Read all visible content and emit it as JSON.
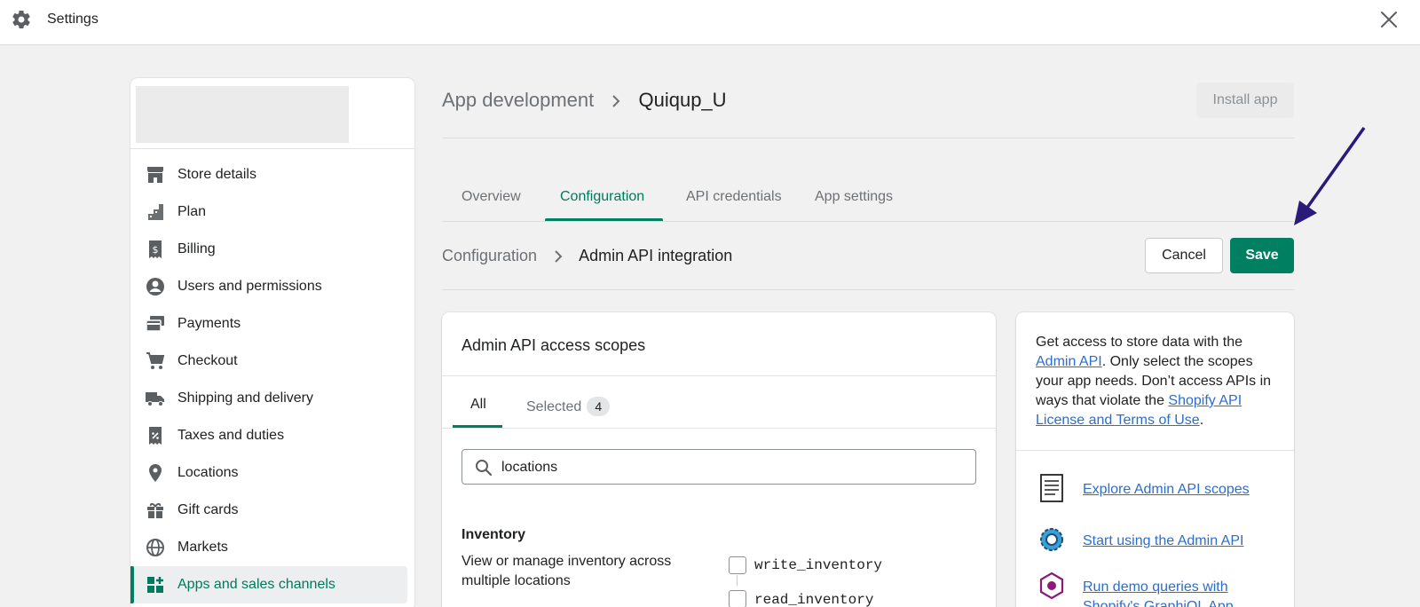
{
  "window": {
    "title": "Settings",
    "icons": {
      "settings": "gear-icon",
      "close": "close-icon"
    }
  },
  "sidebar": {
    "items": [
      {
        "label": "Store details",
        "icon": "store-icon"
      },
      {
        "label": "Plan",
        "icon": "plan-icon"
      },
      {
        "label": "Billing",
        "icon": "billing-icon"
      },
      {
        "label": "Users and permissions",
        "icon": "user-icon"
      },
      {
        "label": "Payments",
        "icon": "payments-icon"
      },
      {
        "label": "Checkout",
        "icon": "cart-icon"
      },
      {
        "label": "Shipping and delivery",
        "icon": "truck-icon"
      },
      {
        "label": "Taxes and duties",
        "icon": "tax-icon"
      },
      {
        "label": "Locations",
        "icon": "location-pin-icon"
      },
      {
        "label": "Gift cards",
        "icon": "gift-icon"
      },
      {
        "label": "Markets",
        "icon": "globe-icon"
      },
      {
        "label": "Apps and sales channels",
        "icon": "apps-icon",
        "active": true
      }
    ]
  },
  "header": {
    "breadcrumb_parent": "App development",
    "breadcrumb_current": "Quiqup_U",
    "install_label": "Install app"
  },
  "tabs": [
    "Overview",
    "Configuration",
    "API credentials",
    "App settings"
  ],
  "active_tab": "Configuration",
  "subheader": {
    "breadcrumb_parent": "Configuration",
    "breadcrumb_current": "Admin API integration",
    "cancel_label": "Cancel",
    "save_label": "Save"
  },
  "colors": {
    "accent": "#008060",
    "link": "#2c6ecb",
    "annotation_arrow": "#2a1a7a"
  },
  "scopes_card": {
    "title": "Admin API access scopes",
    "tab_all": "All",
    "tab_selected": "Selected",
    "selected_count": "4",
    "search_value": "locations",
    "section_title": "Inventory",
    "section_desc": "View or manage inventory across multiple locations",
    "checkboxes": [
      {
        "label": "write_inventory",
        "checked": false
      },
      {
        "label": "read_inventory",
        "checked": false
      }
    ]
  },
  "side_card": {
    "text_1": "Get access to store data with the ",
    "link_admin_api": "Admin API",
    "text_2": ". Only select the scopes your app needs. Don’t access APIs in ways that violate the ",
    "link_license": "Shopify API License and Terms of Use",
    "text_3": ".",
    "resources": [
      {
        "label": "Explore Admin API scopes",
        "icon": "document-icon"
      },
      {
        "label": "Start using the Admin API",
        "icon": "cog-icon"
      },
      {
        "label": "Run demo queries with Shopify's GraphiQL App",
        "icon": "graphql-icon"
      }
    ]
  }
}
